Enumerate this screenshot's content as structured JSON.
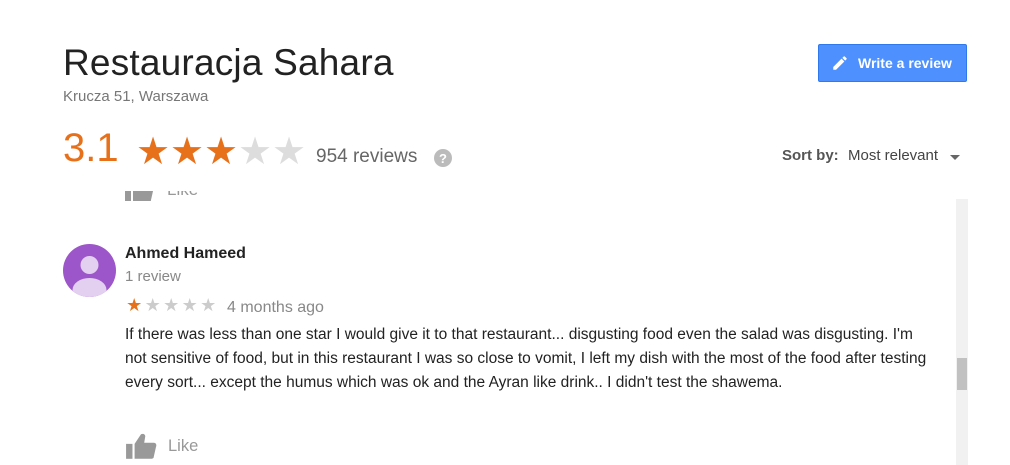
{
  "place": {
    "name": "Restauracja Sahara",
    "address": "Krucza 51, Warszawa"
  },
  "actions": {
    "write_review_label": "Write a review"
  },
  "summary": {
    "rating": "3.1",
    "rating_value": 3.1,
    "stars_filled": 3,
    "stars_total": 5,
    "reviews_label": "954 reviews",
    "help_glyph": "?"
  },
  "sort": {
    "label": "Sort by:",
    "value": "Most relevant"
  },
  "review": {
    "author": "Ahmed Hameed",
    "author_reviews": "1 review",
    "stars_filled": 1,
    "stars_total": 5,
    "time": "4 months ago",
    "text": "If there was less than one star I would give it to that restaurant... disgusting food even the salad was disgusting. I'm not sensitive of food, but in this restaurant I was so close to vomit, I left my dish with the most of the food after testing every sort... except the humus which was ok and the Ayran like drink.. I didn't test the shawema.",
    "like_label": "Like"
  },
  "previous_review": {
    "like_label": "Like"
  },
  "icons": {
    "write": "pencil-icon",
    "help": "help-icon",
    "sort": "caret-down-icon",
    "like": "thumbs-up-icon",
    "avatar": "person-icon"
  },
  "colors": {
    "accent_orange": "#e7711b",
    "button_blue": "#4d90fe",
    "star_empty": "#dddddd",
    "avatar_purple": "#9c56c9",
    "muted_text": "#777777"
  }
}
